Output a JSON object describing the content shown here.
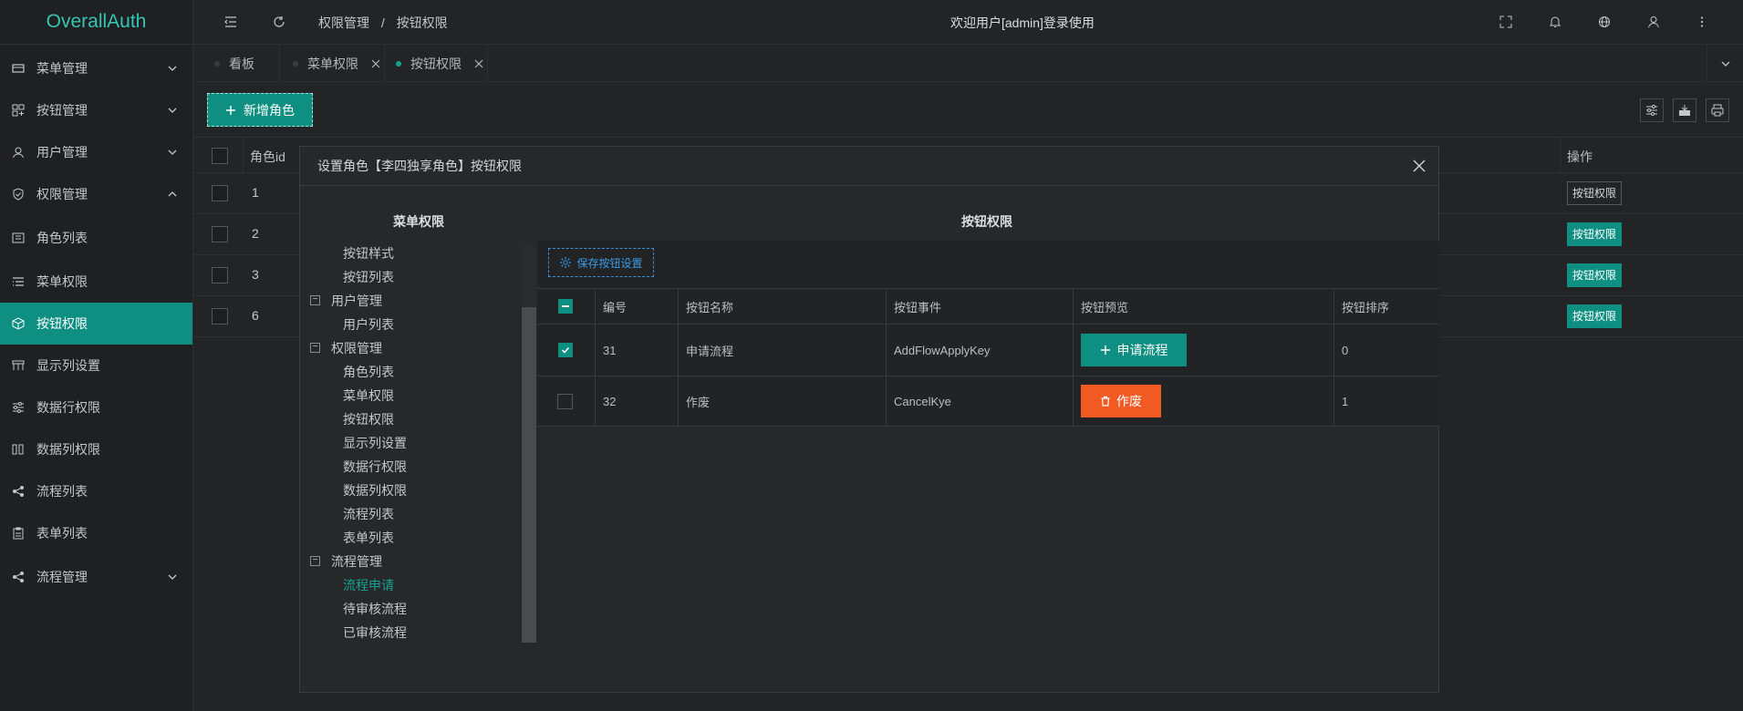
{
  "app": {
    "logo": "OverallAuth"
  },
  "sidebar": {
    "items": [
      {
        "label": "菜单管理",
        "icon": "menu-manage-icon",
        "expandable": true
      },
      {
        "label": "按钮管理",
        "icon": "button-manage-icon",
        "expandable": true
      },
      {
        "label": "用户管理",
        "icon": "user-icon",
        "expandable": true
      },
      {
        "label": "权限管理",
        "icon": "shield-icon",
        "expandable": true,
        "expanded": true
      },
      {
        "label": "角色列表",
        "icon": "role-list-icon"
      },
      {
        "label": "菜单权限",
        "icon": "menu-perm-icon"
      },
      {
        "label": "按钮权限",
        "icon": "cube-icon",
        "active": true
      },
      {
        "label": "显示列设置",
        "icon": "column-setting-icon"
      },
      {
        "label": "数据行权限",
        "icon": "sliders-icon"
      },
      {
        "label": "数据列权限",
        "icon": "columns-icon"
      },
      {
        "label": "流程列表",
        "icon": "share-icon"
      },
      {
        "label": "表单列表",
        "icon": "form-icon"
      },
      {
        "label": "流程管理",
        "icon": "share-icon",
        "expandable": true
      }
    ]
  },
  "header": {
    "breadcrumb": [
      "权限管理",
      "按钮权限"
    ],
    "breadcrumb_sep": "/",
    "welcome": "欢迎用户[admin]登录使用"
  },
  "tabs": [
    {
      "label": "看板",
      "closable": false
    },
    {
      "label": "菜单权限",
      "closable": true
    },
    {
      "label": "按钮权限",
      "closable": true,
      "active": true
    }
  ],
  "main": {
    "add_role_label": "新增角色",
    "table": {
      "col_id": "角色id",
      "col_op": "操作",
      "rows": [
        {
          "id": "1",
          "op": "按钮权限"
        },
        {
          "id": "2",
          "op": "按钮权限"
        },
        {
          "id": "3",
          "op": "按钮权限"
        },
        {
          "id": "6",
          "op": "按钮权限"
        }
      ]
    }
  },
  "dialog": {
    "title": "设置角色【李四独享角色】按钮权限",
    "left_title": "菜单权限",
    "right_title": "按钮权限",
    "tree": [
      {
        "label": "按钮样式",
        "level": 2
      },
      {
        "label": "按钮列表",
        "level": 2
      },
      {
        "label": "用户管理",
        "level": 1,
        "toggle": "−"
      },
      {
        "label": "用户列表",
        "level": 2
      },
      {
        "label": "权限管理",
        "level": 1,
        "toggle": "−"
      },
      {
        "label": "角色列表",
        "level": 2
      },
      {
        "label": "菜单权限",
        "level": 2
      },
      {
        "label": "按钮权限",
        "level": 2
      },
      {
        "label": "显示列设置",
        "level": 2
      },
      {
        "label": "数据行权限",
        "level": 2
      },
      {
        "label": "数据列权限",
        "level": 2
      },
      {
        "label": "流程列表",
        "level": 2
      },
      {
        "label": "表单列表",
        "level": 2
      },
      {
        "label": "流程管理",
        "level": 1,
        "toggle": "−"
      },
      {
        "label": "流程申请",
        "level": 2,
        "highlight": true
      },
      {
        "label": "待审核流程",
        "level": 2
      },
      {
        "label": "已审核流程",
        "level": 2
      }
    ],
    "save_label": "保存按钮设置",
    "button_table": {
      "headers": [
        "编号",
        "按钮名称",
        "按钮事件",
        "按钮预览",
        "按钮排序"
      ],
      "rows": [
        {
          "checked": true,
          "id": "31",
          "name": "申请流程",
          "event": "AddFlowApplyKey",
          "preview": "申请流程",
          "preview_style": "primary",
          "sort": "0"
        },
        {
          "checked": false,
          "id": "32",
          "name": "作废",
          "event": "CancelKye",
          "preview": "作废",
          "preview_style": "danger",
          "sort": "1"
        }
      ]
    }
  },
  "colors": {
    "accent": "#0f8f82",
    "accent_text": "#36c5b3",
    "danger": "#f25a23",
    "bg": "#232425"
  }
}
